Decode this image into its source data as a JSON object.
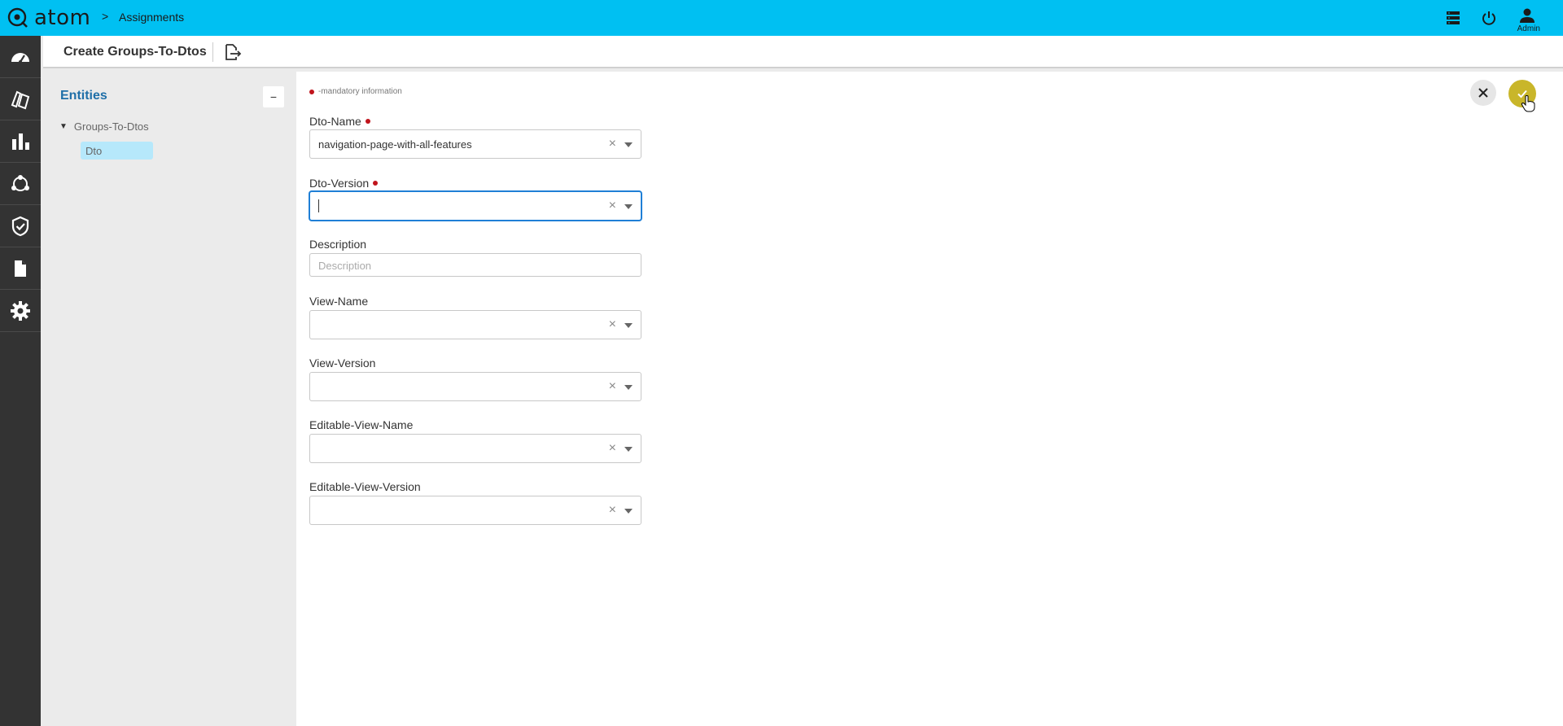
{
  "app": {
    "logo_text": "atom",
    "breadcrumb_separator": ">",
    "breadcrumb": "Assignments",
    "user_label": "Admin"
  },
  "header": {
    "title": "Create Groups-To-Dtos"
  },
  "entities": {
    "title": "Entities",
    "collapse_label": "−",
    "tree_parent": "Groups-To-Dtos",
    "tree_arrow": "▼",
    "tree_child": "Dto"
  },
  "form": {
    "mandatory_note": "-mandatory information",
    "fields": [
      {
        "label": "Dto-Name",
        "value": "navigation-page-with-all-features",
        "required": true
      },
      {
        "label": "Dto-Version",
        "value": "",
        "required": true
      },
      {
        "label": "Description",
        "placeholder": "Description",
        "required": false
      },
      {
        "label": "View-Name",
        "value": "",
        "required": false
      },
      {
        "label": "View-Version",
        "value": "",
        "required": false
      },
      {
        "label": "Editable-View-Name",
        "value": "",
        "required": false
      },
      {
        "label": "Editable-View-Version",
        "value": "",
        "required": false
      }
    ],
    "clear_glyph": "×"
  },
  "colors": {
    "topbar": "#00c0f2",
    "sidebar": "#333333",
    "accent_blue": "#1f6fa8",
    "confirm": "#c9b62a",
    "required_dot": "#c0141c"
  },
  "icons": {
    "nav": [
      "dashboard-icon",
      "cards-icon",
      "bar-chart-icon",
      "network-icon",
      "shield-check-icon",
      "document-icon",
      "gear-icon"
    ],
    "top": [
      "server-icon",
      "power-icon",
      "user-icon"
    ]
  }
}
